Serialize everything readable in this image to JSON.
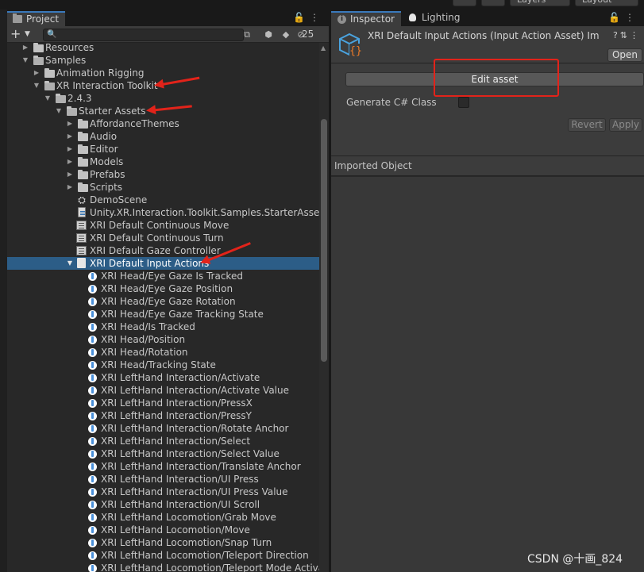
{
  "top_toolbar": {
    "layers_label": "Layers",
    "layout_label": "Layout"
  },
  "project_panel": {
    "tab_label": "Project",
    "search_placeholder": "",
    "hidden_packages_count": "25",
    "tree": [
      {
        "label": "Resources",
        "icon": "folder-icon",
        "expanded": false
      },
      {
        "label": "Samples",
        "icon": "folder-icon",
        "expanded": true
      },
      {
        "label": "Animation Rigging",
        "icon": "folder-icon",
        "expanded": false
      },
      {
        "label": "XR Interaction Toolkit",
        "icon": "folder-icon",
        "expanded": true
      },
      {
        "label": "2.4.3",
        "icon": "folder-icon",
        "expanded": true
      },
      {
        "label": "Starter Assets",
        "icon": "folder-icon",
        "expanded": true
      },
      {
        "label": "AffordanceThemes",
        "icon": "folder-icon",
        "expanded": false
      },
      {
        "label": "Audio",
        "icon": "folder-icon",
        "expanded": false
      },
      {
        "label": "Editor",
        "icon": "folder-icon",
        "expanded": false
      },
      {
        "label": "Models",
        "icon": "folder-icon",
        "expanded": false
      },
      {
        "label": "Prefabs",
        "icon": "folder-icon",
        "expanded": false
      },
      {
        "label": "Scripts",
        "icon": "folder-icon",
        "expanded": false
      },
      {
        "label": "DemoScene",
        "icon": "unity-scene-icon"
      },
      {
        "label": "Unity.XR.Interaction.Toolkit.Samples.StarterAssets",
        "icon": "assembly-definition-icon"
      },
      {
        "label": "XRI Default Continuous Move",
        "icon": "preset-icon"
      },
      {
        "label": "XRI Default Continuous Turn",
        "icon": "preset-icon"
      },
      {
        "label": "XRI Default Gaze Controller",
        "icon": "preset-icon"
      },
      {
        "label": "XRI Default Input Actions",
        "icon": "input-actions-icon",
        "expanded": true,
        "selected": true
      },
      {
        "label": "XRI Head/Eye Gaze Is Tracked",
        "icon": "input-action-icon"
      },
      {
        "label": "XRI Head/Eye Gaze Position",
        "icon": "input-action-icon"
      },
      {
        "label": "XRI Head/Eye Gaze Rotation",
        "icon": "input-action-icon"
      },
      {
        "label": "XRI Head/Eye Gaze Tracking State",
        "icon": "input-action-icon"
      },
      {
        "label": "XRI Head/Is Tracked",
        "icon": "input-action-icon"
      },
      {
        "label": "XRI Head/Position",
        "icon": "input-action-icon"
      },
      {
        "label": "XRI Head/Rotation",
        "icon": "input-action-icon"
      },
      {
        "label": "XRI Head/Tracking State",
        "icon": "input-action-icon"
      },
      {
        "label": "XRI LeftHand Interaction/Activate",
        "icon": "input-action-icon"
      },
      {
        "label": "XRI LeftHand Interaction/Activate Value",
        "icon": "input-action-icon"
      },
      {
        "label": "XRI LeftHand Interaction/PressX",
        "icon": "input-action-icon"
      },
      {
        "label": "XRI LeftHand Interaction/PressY",
        "icon": "input-action-icon"
      },
      {
        "label": "XRI LeftHand Interaction/Rotate Anchor",
        "icon": "input-action-icon"
      },
      {
        "label": "XRI LeftHand Interaction/Select",
        "icon": "input-action-icon"
      },
      {
        "label": "XRI LeftHand Interaction/Select Value",
        "icon": "input-action-icon"
      },
      {
        "label": "XRI LeftHand Interaction/Translate Anchor",
        "icon": "input-action-icon"
      },
      {
        "label": "XRI LeftHand Interaction/UI Press",
        "icon": "input-action-icon"
      },
      {
        "label": "XRI LeftHand Interaction/UI Press Value",
        "icon": "input-action-icon"
      },
      {
        "label": "XRI LeftHand Interaction/UI Scroll",
        "icon": "input-action-icon"
      },
      {
        "label": "XRI LeftHand Locomotion/Grab Move",
        "icon": "input-action-icon"
      },
      {
        "label": "XRI LeftHand Locomotion/Move",
        "icon": "input-action-icon"
      },
      {
        "label": "XRI LeftHand Locomotion/Snap Turn",
        "icon": "input-action-icon"
      },
      {
        "label": "XRI LeftHand Locomotion/Teleport Direction",
        "icon": "input-action-icon"
      },
      {
        "label": "XRI LeftHand Locomotion/Teleport Mode Activate",
        "icon": "input-action-icon"
      }
    ]
  },
  "inspector_panel": {
    "tab_label": "Inspector",
    "lighting_tab_label": "Lighting",
    "asset_title": "XRI Default Input Actions (Input Action Asset) Im",
    "open_button": "Open",
    "edit_asset_button": "Edit asset",
    "generate_csharp_label": "Generate C# Class",
    "generate_csharp_checked": false,
    "revert_button": "Revert",
    "apply_button": "Apply",
    "imported_object_label": "Imported Object"
  },
  "watermark": "CSDN @十画_824",
  "colors": {
    "selection": "#2c5d87",
    "annotation_red": "#e2231a",
    "tab_accent": "#3a79bb"
  }
}
